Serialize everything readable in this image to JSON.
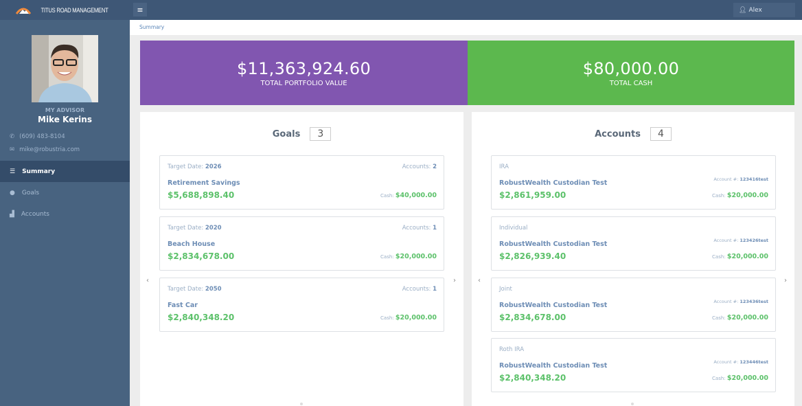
{
  "header": {
    "brand": "TITUS ROAD MANAGEMENT",
    "menu_icon": "hamburger-icon",
    "user": "Alex"
  },
  "sidebar": {
    "advisor_label": "MY ADVISOR",
    "advisor_name": "Mike Kerins",
    "phone": "(609) 483-8104",
    "email": "mike@robustria.com",
    "nav": [
      {
        "label": "Summary",
        "icon": "list-icon",
        "active": true
      },
      {
        "label": "Goals",
        "icon": "circle-icon",
        "active": false
      },
      {
        "label": "Accounts",
        "icon": "chart-icon",
        "active": false
      }
    ]
  },
  "breadcrumb": "Summary",
  "stats": {
    "portfolio": {
      "value": "$11,363,924.60",
      "label": "TOTAL PORTFOLIO VALUE",
      "color": "#8156b0"
    },
    "cash": {
      "value": "$80,000.00",
      "label": "TOTAL CASH",
      "color": "#5cb84e"
    }
  },
  "goals": {
    "title": "Goals",
    "count": "3",
    "items": [
      {
        "target_label": "Target Date:",
        "target": "2026",
        "accounts_label": "Accounts:",
        "accounts": "2",
        "name": "Retirement Savings",
        "value": "$5,688,898.40",
        "cash_label": "Cash:",
        "cash": "$40,000.00"
      },
      {
        "target_label": "Target Date:",
        "target": "2020",
        "accounts_label": "Accounts:",
        "accounts": "1",
        "name": "Beach House",
        "value": "$2,834,678.00",
        "cash_label": "Cash:",
        "cash": "$20,000.00"
      },
      {
        "target_label": "Target Date:",
        "target": "2050",
        "accounts_label": "Accounts:",
        "accounts": "1",
        "name": "Fast Car",
        "value": "$2,840,348.20",
        "cash_label": "Cash:",
        "cash": "$20,000.00"
      }
    ]
  },
  "accounts": {
    "title": "Accounts",
    "count": "4",
    "items": [
      {
        "type": "IRA",
        "name": "RobustWealth Custodian Test",
        "value": "$2,861,959.00",
        "acct_label": "Account #:",
        "acct": "123416test",
        "cash_label": "Cash:",
        "cash": "$20,000.00"
      },
      {
        "type": "Individual",
        "name": "RobustWealth Custodian Test",
        "value": "$2,826,939.40",
        "acct_label": "Account #:",
        "acct": "123426test",
        "cash_label": "Cash:",
        "cash": "$20,000.00"
      },
      {
        "type": "Joint",
        "name": "RobustWealth Custodian Test",
        "value": "$2,834,678.00",
        "acct_label": "Account #:",
        "acct": "123436test",
        "cash_label": "Cash:",
        "cash": "$20,000.00"
      },
      {
        "type": "Roth IRA",
        "name": "RobustWealth Custodian Test",
        "value": "$2,840,348.20",
        "acct_label": "Account #:",
        "acct": "123446test",
        "cash_label": "Cash:",
        "cash": "$20,000.00"
      }
    ]
  },
  "carousel": {
    "prev": "‹",
    "next": "›"
  }
}
